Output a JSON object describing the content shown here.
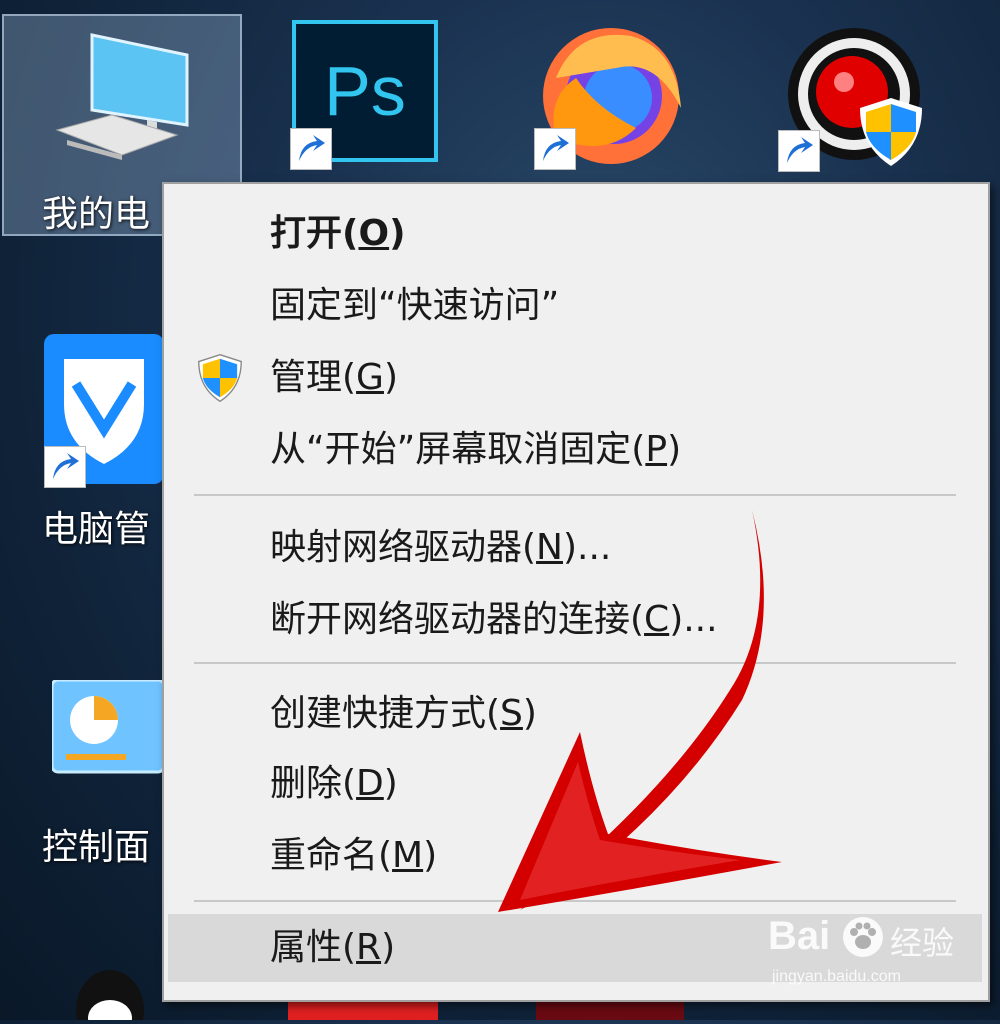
{
  "desktop": {
    "icons": [
      {
        "name": "computer",
        "label": "我的电"
      },
      {
        "name": "tencent-manager",
        "label": "电脑管"
      },
      {
        "name": "control-panel",
        "label": "控制面"
      }
    ]
  },
  "menu": {
    "items": [
      {
        "pre": "打开(",
        "key": "O",
        "post": ")",
        "bold": true
      },
      {
        "pre": "固定到“快速访问”",
        "key": "",
        "post": ""
      },
      {
        "pre": "管理(",
        "key": "G",
        "post": ")"
      },
      {
        "pre": "从“开始”屏幕取消固定(",
        "key": "P",
        "post": ")"
      },
      {
        "pre": "映射网络驱动器(",
        "key": "N",
        "post": ")..."
      },
      {
        "pre": "断开网络驱动器的连接(",
        "key": "C",
        "post": ")..."
      },
      {
        "pre": "创建快捷方式(",
        "key": "S",
        "post": ")"
      },
      {
        "pre": "删除(",
        "key": "D",
        "post": ")"
      },
      {
        "pre": "重命名(",
        "key": "M",
        "post": ")"
      },
      {
        "pre": "属性(",
        "key": "R",
        "post": ")",
        "hover": true
      }
    ]
  },
  "watermark": {
    "brand": "Bai",
    "brand2": "经验",
    "url": "jingyan.baidu.com"
  },
  "colors": {
    "arrow": "#d40000",
    "menu_bg": "#f0f0f0",
    "hover_bg": "#d9d9d9"
  }
}
